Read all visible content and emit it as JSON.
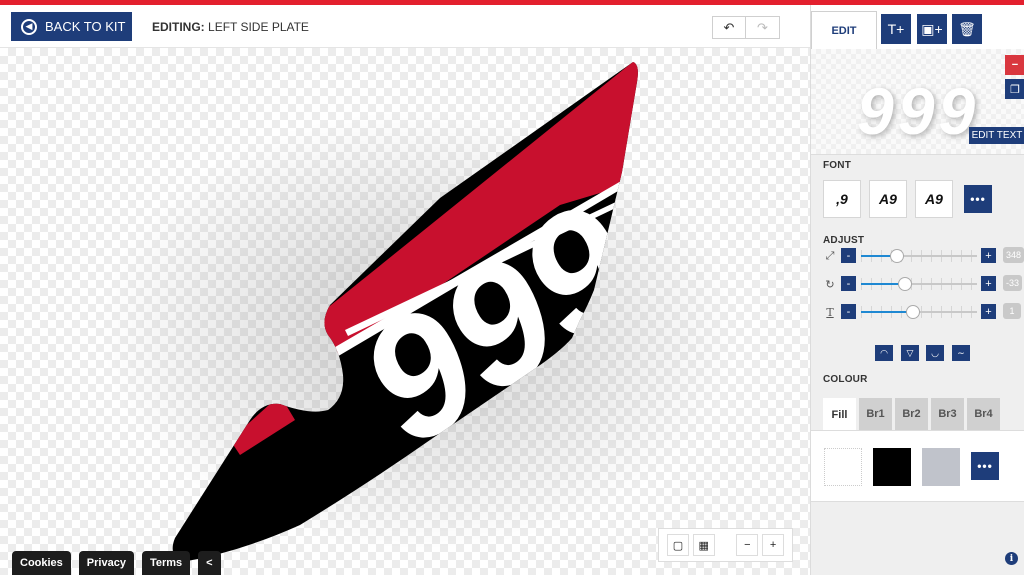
{
  "header": {
    "back_label": "BACK TO KIT",
    "editing_prefix": "EDITING:",
    "editing_value": "LEFT SIDE PLATE",
    "undo_icon": "↶",
    "redo_icon": "↷"
  },
  "canvas": {
    "plate_number": "999",
    "colors": {
      "red": "#c8102e",
      "black": "#000000",
      "white": "#ffffff"
    }
  },
  "view_tools": {
    "single_view_icon": "▢",
    "grid_view_icon": "▦",
    "zoom_out_icon": "−",
    "zoom_in_icon": "+"
  },
  "footer": {
    "links": [
      "Cookies",
      "Privacy",
      "Terms"
    ],
    "collapse_label": "<"
  },
  "panel": {
    "tab_edit": "EDIT",
    "add_text_icon": "T+",
    "add_image_icon": "▣+",
    "delete_icon": "🗑",
    "preview_text": "999",
    "edit_text_label": "EDIT TEXT",
    "remove_icon": "−",
    "copy_icon": "❐",
    "font_label": "FONT",
    "fonts": [
      ",9",
      "A9",
      "A9"
    ],
    "more_label": "•••",
    "adjust_label": "ADJUST",
    "adjust": {
      "size": {
        "icon": "⤢",
        "value": "348",
        "level": 0.31
      },
      "rotate": {
        "icon": "↻",
        "value": "-33",
        "level": 0.38
      },
      "spacing": {
        "icon": "T",
        "value": "1",
        "level": 0.45
      }
    },
    "colour_label": "COLOUR",
    "colour_tabs": [
      "Fill",
      "Br1",
      "Br2",
      "Br3",
      "Br4"
    ],
    "swatches": [
      "#ffffff",
      "#000000",
      "#c0c3cb"
    ],
    "info_icon": "i"
  }
}
